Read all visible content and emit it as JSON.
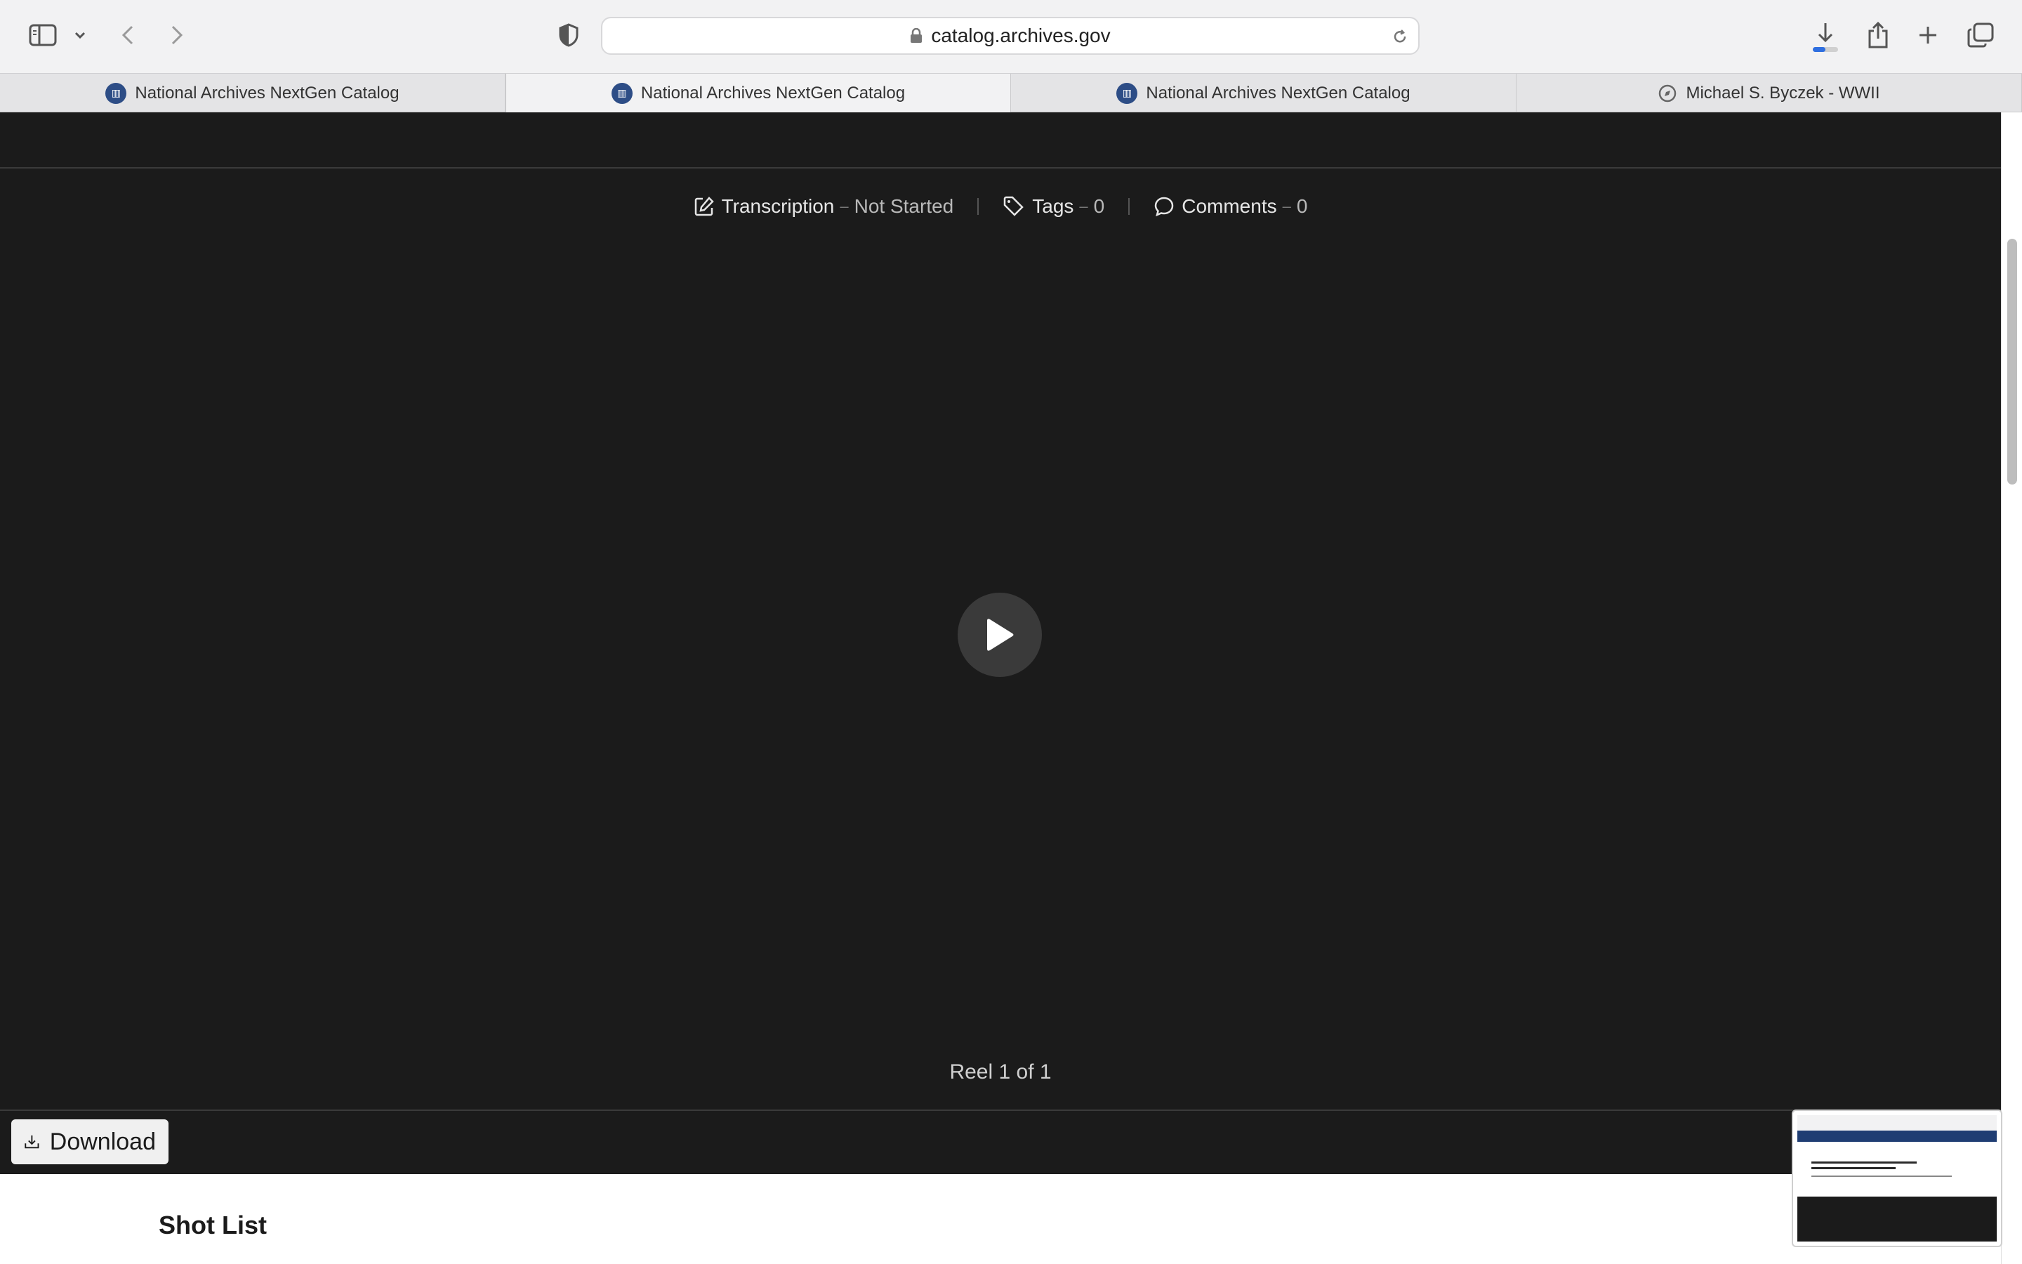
{
  "browser": {
    "url": "catalog.archives.gov",
    "tabs": [
      {
        "label": "National Archives NextGen Catalog",
        "icon": "archives-favicon",
        "active": false
      },
      {
        "label": "National Archives NextGen Catalog",
        "icon": "archives-favicon",
        "active": true
      },
      {
        "label": "National Archives NextGen Catalog",
        "icon": "archives-favicon",
        "active": false
      },
      {
        "label": "Michael S. Byczek - WWII",
        "icon": "compass-icon",
        "active": false
      }
    ],
    "download_progress": 0.5
  },
  "viewer": {
    "transcription_label": "Transcription",
    "transcription_status": "Not Started",
    "tags_label": "Tags",
    "tags_count": "0",
    "comments_label": "Comments",
    "comments_count": "0",
    "separator": "–",
    "reel_text": "Reel 1 of 1"
  },
  "download_label": "Download",
  "section_title": "Shot List",
  "colors": {
    "viewer_bg": "#1b1b1b",
    "nav_blue": "#1f3d73",
    "download_accent": "#2f6fe0"
  }
}
